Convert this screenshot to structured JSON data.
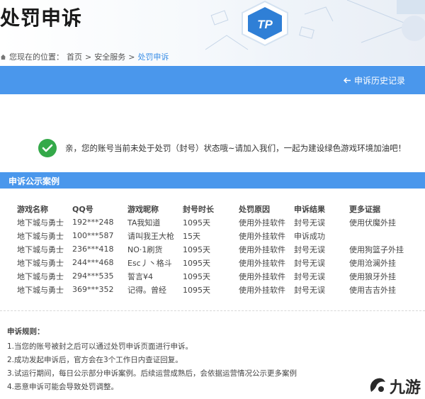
{
  "header": {
    "title": "处罚申诉",
    "logo_text": "TP",
    "breadcrumb": {
      "prefix": "您现在的位置：",
      "items": [
        "首页",
        "安全服务",
        "处罚申诉"
      ],
      "separator": ">"
    }
  },
  "toolbar": {
    "history_label": "申诉历史记录",
    "history_icon": "arrow-left-icon"
  },
  "status": {
    "message": "亲，您的账号当前未处于处罚（封号）状态哦~请加入我们，一起为建设绿色游戏环境加油吧！",
    "icon": "check-circle-icon"
  },
  "cases": {
    "section_title": "申诉公示案例",
    "columns": [
      "游戏名称",
      "QQ号",
      "游戏昵称",
      "封号时长",
      "处罚原因",
      "申诉结果",
      "更多证据"
    ],
    "rows": [
      [
        "地下城与勇士",
        "192***248",
        "TA我知道",
        "1095天",
        "使用外挂软件",
        "封号无误",
        "使用伏魔外挂"
      ],
      [
        "地下城与勇士",
        "100***587",
        "请叫我王大枪",
        "15天",
        "使用外挂软件",
        "申诉成功",
        ""
      ],
      [
        "地下城与勇士",
        "236***418",
        "NO·1刷货",
        "1095天",
        "使用外挂软件",
        "封号无误",
        "使用狗篮子外挂"
      ],
      [
        "地下城与勇士",
        "244***468",
        "Esc丿丶格斗",
        "1095天",
        "使用外挂软件",
        "封号无误",
        "使用沧澜外挂"
      ],
      [
        "地下城与勇士",
        "294***535",
        "誓言¥4",
        "1095天",
        "使用外挂软件",
        "封号无误",
        "使用狼牙外挂"
      ],
      [
        "地下城与勇士",
        "369***352",
        "记得。曾经",
        "1095天",
        "使用外挂软件",
        "封号无误",
        "使用吉吉外挂"
      ]
    ]
  },
  "rules": {
    "title": "申诉规则：",
    "items": [
      "1.当您的账号被封之后可以通过处罚申诉页面进行申诉。",
      "2.成功发起申诉后，官方会在3个工作日内查证回复。",
      "3.试运行期间，每日公示部分申诉案例。后续运营成熟后，会依据运营情况公示更多案例",
      "4.恶意申诉可能会导致处罚调整。"
    ]
  },
  "watermark": {
    "text": "九游"
  },
  "colors": {
    "accent": "#4a97ec",
    "success": "#34a949",
    "link": "#3a8ee6"
  }
}
